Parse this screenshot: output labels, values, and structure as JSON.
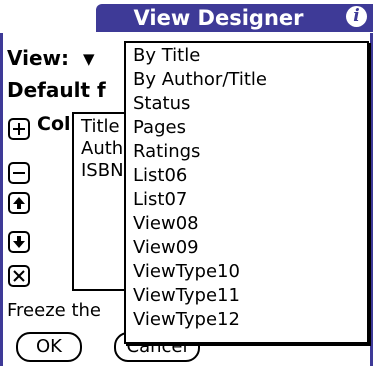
{
  "titlebar": {
    "title": "View Designer",
    "info_icon": "info-icon",
    "info_glyph": "i"
  },
  "view": {
    "label": "View:",
    "arrow": "▼"
  },
  "default": {
    "label": "Default f"
  },
  "columns": {
    "label": "Colun",
    "items": [
      "Title",
      "Autho",
      "ISBN"
    ],
    "buttons": [
      "add-icon",
      "remove-icon",
      "move-up-icon",
      "move-down-icon",
      "delete-icon"
    ]
  },
  "freeze": {
    "label": "Freeze the"
  },
  "buttons": {
    "ok": "OK",
    "cancel": "Cancel"
  },
  "dropdown": {
    "options": [
      "By Title",
      "By Author/Title",
      "Status",
      "Pages",
      "Ratings",
      "List06",
      "List07",
      "View08",
      "View09",
      "ViewType10",
      "ViewType11",
      "ViewType12"
    ]
  },
  "colors": {
    "accent": "#3e3a97",
    "background": "#ffffff",
    "text": "#000000"
  }
}
